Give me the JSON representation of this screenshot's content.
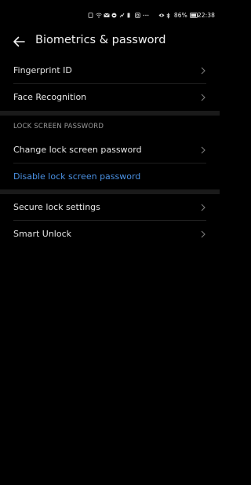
{
  "status_bar": {
    "battery": "86%",
    "time": "22:38",
    "icons": [
      "phone-icon",
      "wifi-icon",
      "mail-icon",
      "message-icon",
      "signal-icon",
      "battery-small-icon",
      "instagram-icon",
      "more-icon",
      "eye-icon",
      "bluetooth-icon",
      "battery-icon"
    ]
  },
  "header": {
    "title": "Biometrics & password",
    "back_icon": "arrow-left-icon"
  },
  "sections": [
    {
      "items": [
        {
          "label": "Fingerprint ID",
          "chevron": true
        },
        {
          "label": "Face Recognition",
          "chevron": true
        }
      ]
    },
    {
      "title": "LOCK SCREEN PASSWORD",
      "items": [
        {
          "label": "Change lock screen password",
          "chevron": true
        },
        {
          "label": "Disable lock screen password",
          "chevron": false
        }
      ]
    },
    {
      "items": [
        {
          "label": "Secure lock settings",
          "chevron": true
        },
        {
          "label": "Smart Unlock",
          "chevron": true
        }
      ]
    }
  ],
  "colors": {
    "background": "#000000",
    "text": "#e6e6e6",
    "accent": "#4a90e2",
    "section_header": "#9a9a9a",
    "separator": "#1a1a1a"
  }
}
